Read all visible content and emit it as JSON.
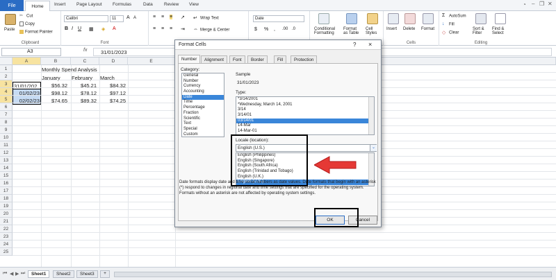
{
  "ribbon": {
    "file_tab": "File",
    "tabs": [
      "Home",
      "Insert",
      "Page Layout",
      "Formulas",
      "Data",
      "Review",
      "View"
    ],
    "cut": "Cut",
    "copy": "Copy",
    "format_painter": "Format Painter",
    "paste": "Paste",
    "clipboard_label": "Clipboard",
    "font_name": "Calibri",
    "font_size": "11",
    "font_label": "Font",
    "wrap_text": "Wrap Text",
    "merge_center": "Merge & Center",
    "number_format": "Date",
    "cond_format_1": "Conditional",
    "cond_format_2": "Formatting",
    "format_table_1": "Format",
    "format_table_2": "as Table",
    "cell_styles_1": "Cell",
    "cell_styles_2": "Styles",
    "insert": "Insert",
    "delete": "Delete",
    "format": "Format",
    "cells_label": "Cells",
    "autosum": "AutoSum",
    "fill": "Fill",
    "clear": "Clear",
    "sort_1": "Sort &",
    "sort_2": "Filter",
    "find_1": "Find &",
    "find_2": "Select",
    "editing_label": "Editing"
  },
  "formula_bar": {
    "name_box": "A3",
    "fx": "fx",
    "formula": "31/01/2023"
  },
  "grid": {
    "columns": [
      "A",
      "B",
      "C",
      "D",
      "E"
    ],
    "rows": [
      "1",
      "2",
      "3",
      "4",
      "5",
      "6",
      "7",
      "8",
      "9",
      "10",
      "11",
      "12",
      "13",
      "14",
      "15",
      "16",
      "17",
      "18",
      "19",
      "20",
      "21",
      "22",
      "23",
      "24",
      "25"
    ],
    "title": "Monthly Spend Analysis",
    "headers": [
      "January",
      "February",
      "March"
    ],
    "dates": [
      "31/01/202",
      "01/02/23",
      "02/02/23"
    ],
    "data": [
      [
        "$56.32",
        "$45.21",
        "$84.32"
      ],
      [
        "$98.12",
        "$78.12",
        "$97.12"
      ],
      [
        "$74.65",
        "$89.32",
        "$74.25"
      ]
    ]
  },
  "sheets": [
    "Sheet1",
    "Sheet2",
    "Sheet3"
  ],
  "dialog": {
    "title": "Format Cells",
    "help": "?",
    "close": "×",
    "tabs": [
      "Number",
      "Alignment",
      "Font",
      "Border",
      "Fill",
      "Protection"
    ],
    "category_label": "Category:",
    "categories": [
      "General",
      "Number",
      "Currency",
      "Accounting",
      "Date",
      "Time",
      "Percentage",
      "Fraction",
      "Scientific",
      "Text",
      "Special",
      "Custom"
    ],
    "selected_category": 4,
    "sample_label": "Sample",
    "sample_value": "31/01/2023",
    "type_label": "Type:",
    "types": [
      "*3/14/2001",
      "*Wednesday, March 14, 2001",
      "3/14",
      "3/14/01",
      "03/14/01",
      "14-Mar",
      "14-Mar-01"
    ],
    "selected_type": 4,
    "locale_label": "Locale (location):",
    "locale_value": "English (U.S.)",
    "locales": [
      "English (Philippines)",
      "English (Singapore)",
      "English (South Africa)",
      "English (Trinidad and Tobago)",
      "English (U.K.)",
      "English (U.S.)"
    ],
    "selected_locale": 5,
    "description": "Date formats display date and time serial numbers as date values. Date formats that begin with an asterisk (*) respond to changes in regional date and time settings that are specified for the operating system. Formats without an asterisk are not affected by operating system settings.",
    "ok": "OK",
    "cancel": "Cancel"
  },
  "colors": {
    "accent": "#2a6cc4",
    "selection": "#3a86d9",
    "arrow": "#e53935",
    "highlight_box": "#000000"
  }
}
